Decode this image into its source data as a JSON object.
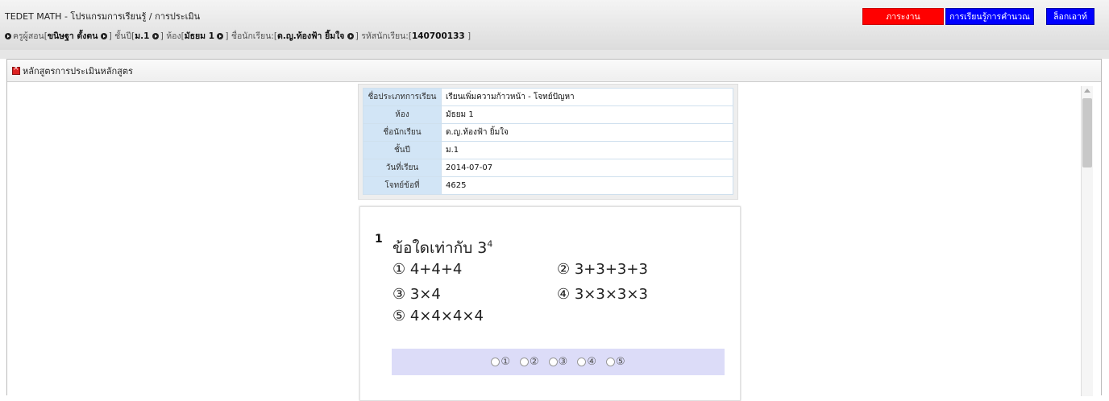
{
  "header": {
    "title": "TEDET MATH - โปรแกรมการเรียนรู้ / การประเมิน",
    "teacher_label": "ครูผู้สอน[",
    "teacher": "ขนิษฐา ตั้งตน",
    "grade_label": "] ชั้นปี[",
    "grade": "ม.1",
    "room_label": "] ห้อง[",
    "room": "มัธยม 1",
    "student_label": "] ชื่อนักเรียน:[",
    "student": "ด.ญ.ท้องฟ้า ยิ้มใจ",
    "student_id_label": "] รหัสนักเรียน:[",
    "student_id": "140700133",
    "end_bracket": "]"
  },
  "nav": {
    "report": "ภาระงาน",
    "learn": "การเรียนรู้การคำนวณ",
    "logout": "ล็อกเอาท์"
  },
  "colors": {
    "report": "#ff0000",
    "learn": "#0000ff",
    "logout": "#0000ff"
  },
  "panel": {
    "title": "หลักสูตรการประเมินหลักสูตร"
  },
  "info": {
    "rows": [
      {
        "label": "ชื่อประเภทการเรียน",
        "value": "เรียนเพิ่มความก้าวหน้า - โจทย์ปัญหา"
      },
      {
        "label": "ห้อง",
        "value": "มัธยม 1"
      },
      {
        "label": "ชื่อนักเรียน",
        "value": "ด.ญ.ท้องฟ้า ยิ้มใจ"
      },
      {
        "label": "ชั้นปี",
        "value": "ม.1"
      },
      {
        "label": "วันที่เรียน",
        "value": "2014-07-07"
      },
      {
        "label": "โจทย์ข้อที่",
        "value": "4625"
      }
    ]
  },
  "question": {
    "number": "1",
    "text": "ข้อใดเท่ากับ 3",
    "exponent": "4",
    "choices": [
      "① 4+4+4",
      "② 3+3+3+3",
      "③ 3×4",
      "④ 3×3×3×3",
      "⑤ 4×4×4×4"
    ]
  },
  "answers": [
    "①",
    "②",
    "③",
    "④",
    "⑤"
  ]
}
